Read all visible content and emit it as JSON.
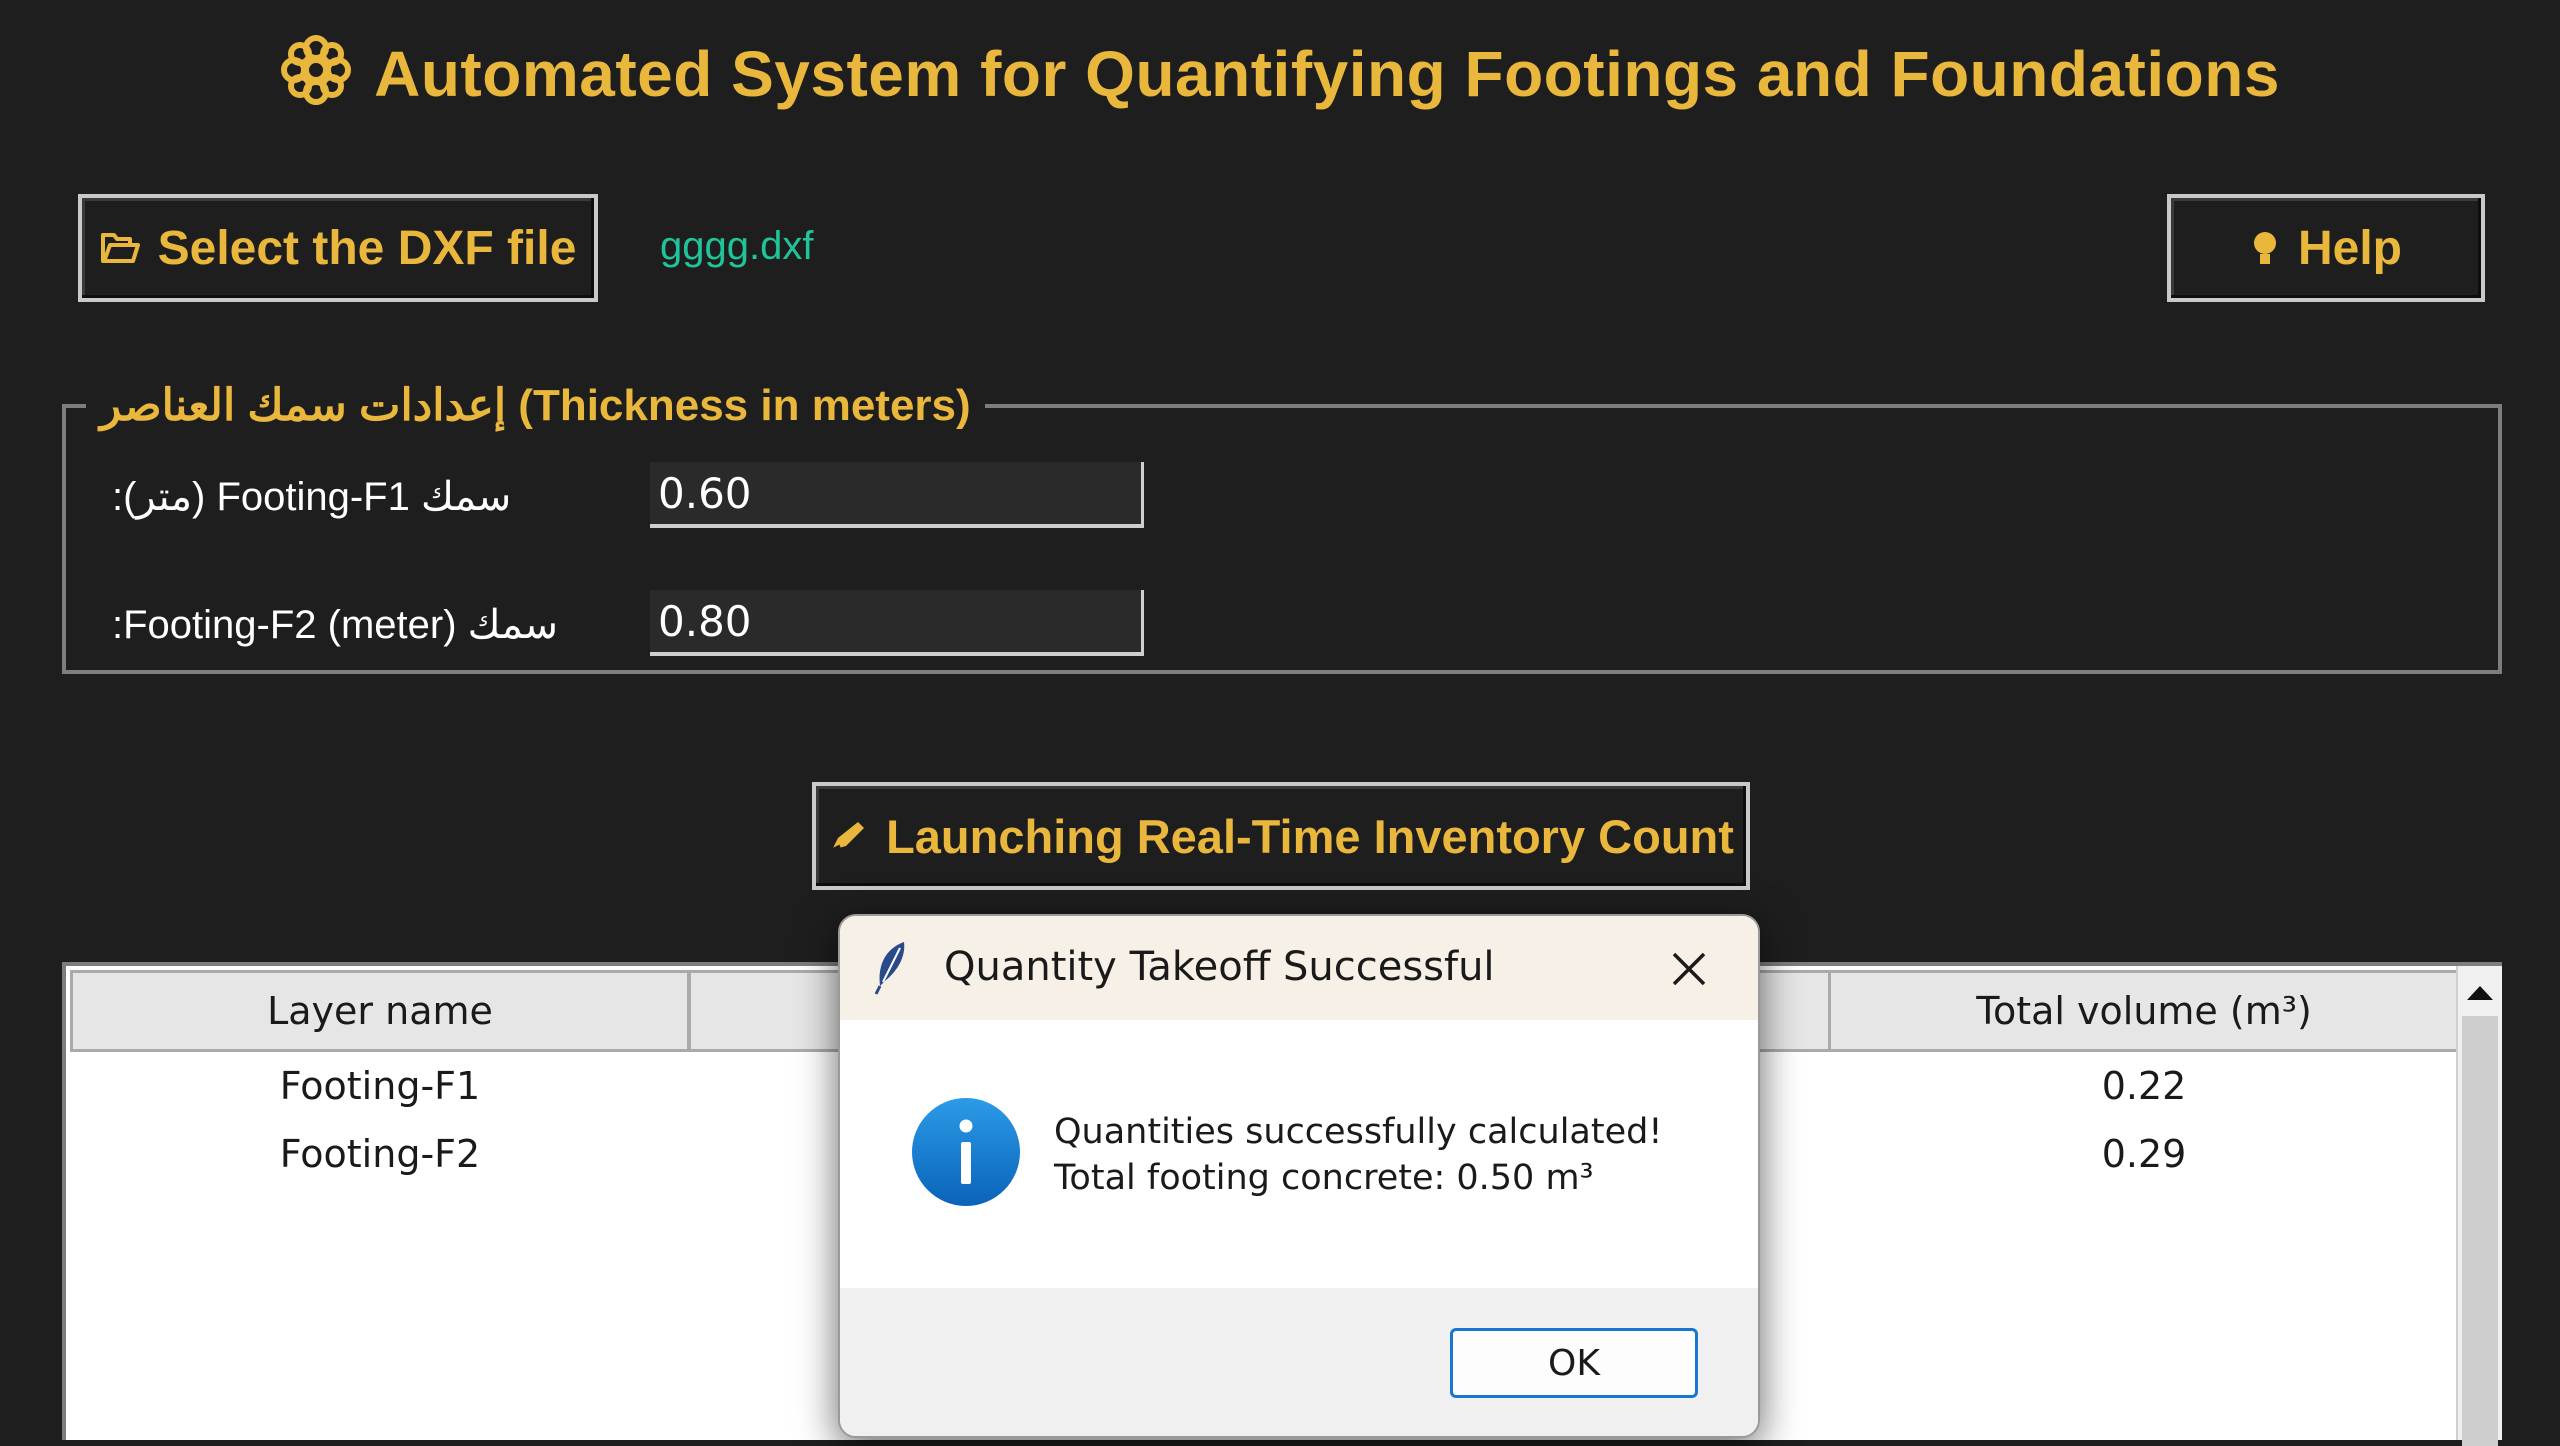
{
  "app": {
    "title": "Automated System for Quantifying Footings and Foundations",
    "title_icon": "gear-icon",
    "accent_color": "#e8b73c"
  },
  "toolbar": {
    "select_label": "Select the DXF file",
    "select_icon": "folder-icon",
    "selected_file": "gggg.dxf",
    "help_label": "Help",
    "help_icon": "lightbulb-icon"
  },
  "settings": {
    "legend": "إعدادات سمك العناصر (Thickness in meters)",
    "fields": [
      {
        "label": "سمك Footing-F1 (متر):",
        "value": "0.60"
      },
      {
        "label": "سمك Footing-F2 (meter):",
        "value": "0.80"
      }
    ]
  },
  "launch": {
    "label": "Launching Real-Time Inventory Count",
    "icon": "pencil-icon"
  },
  "table": {
    "columns": [
      "Layer name",
      "Total volume (m³)"
    ],
    "rows": [
      {
        "layer": "Footing-F1",
        "volume": "0.22"
      },
      {
        "layer": "Footing-F2",
        "volume": "0.29"
      }
    ]
  },
  "dialog": {
    "title": "Quantity Takeoff Successful",
    "message_line1": "Quantities successfully calculated!",
    "message_line2": "Total footing concrete: 0.50 m³",
    "ok_label": "OK",
    "icon": "info-icon"
  }
}
